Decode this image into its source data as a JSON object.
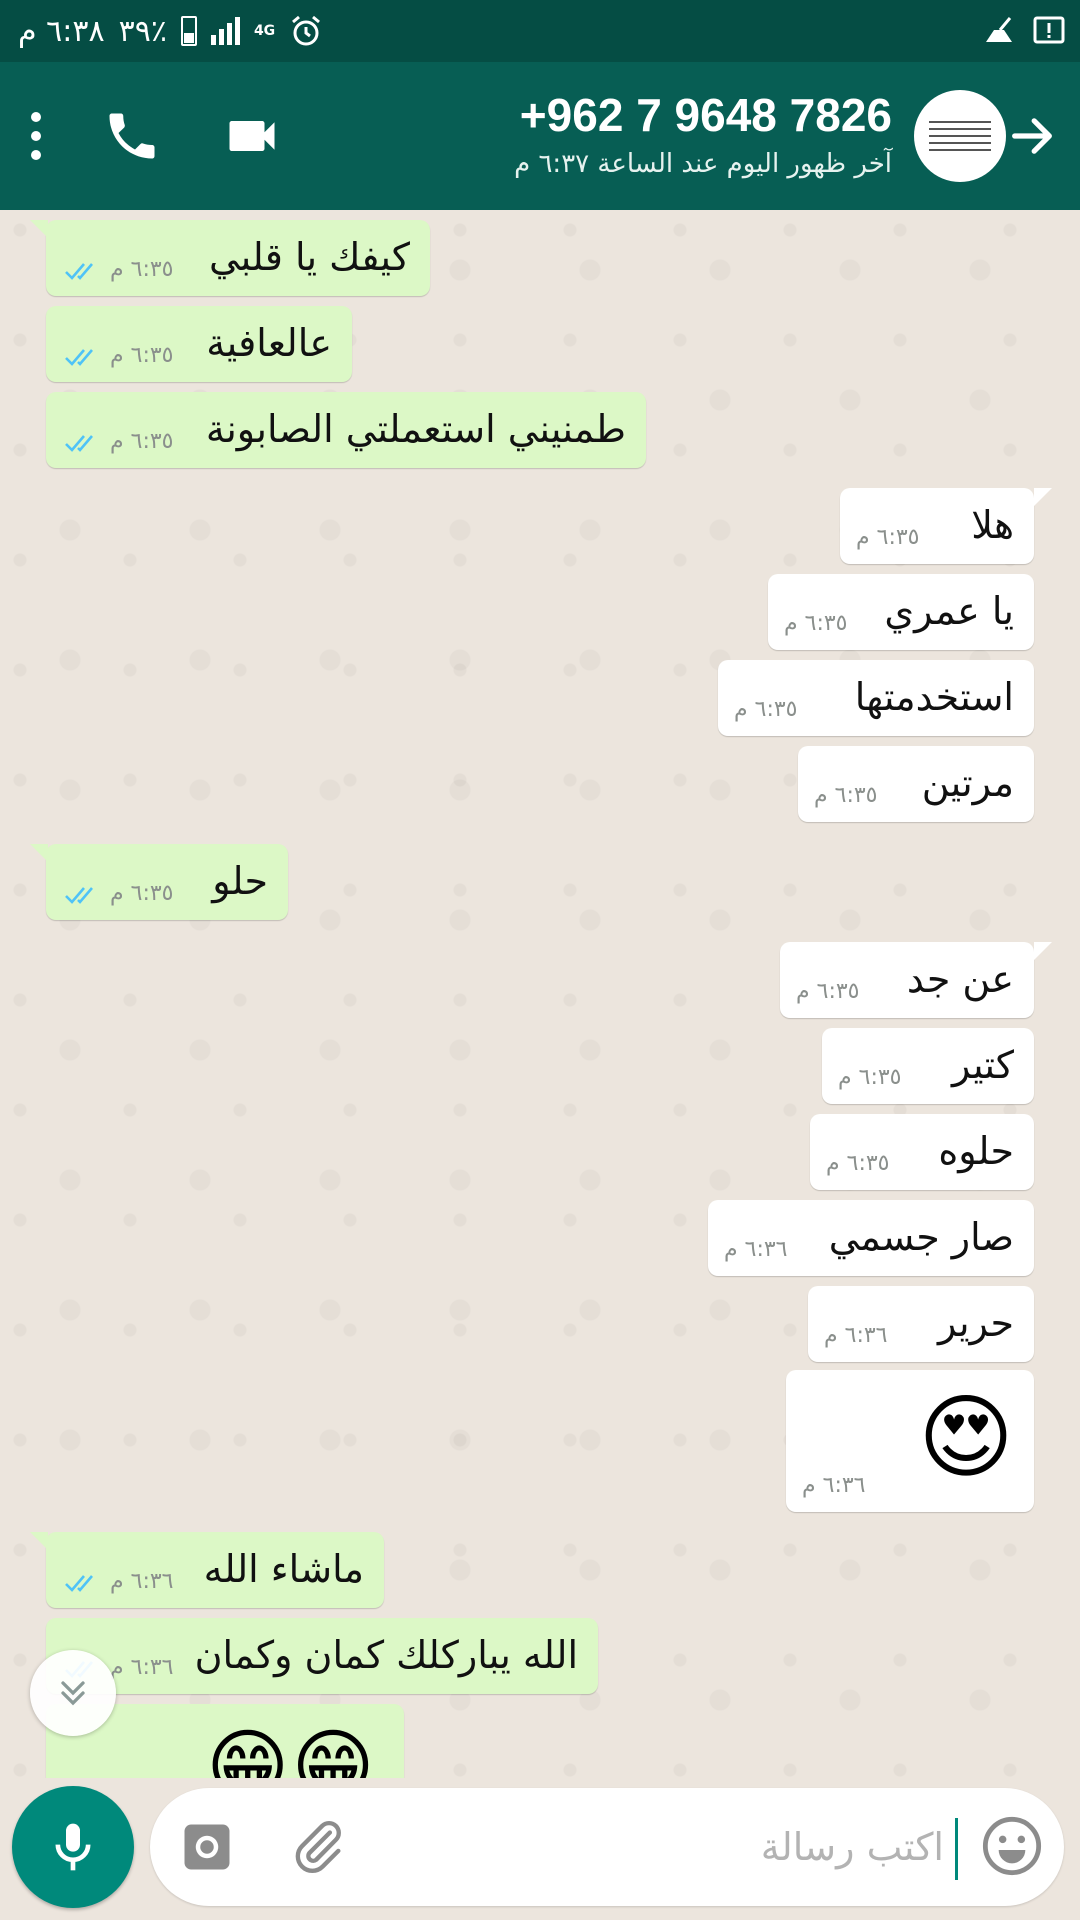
{
  "status_bar": {
    "time": "٦:٣٨ م",
    "battery": "٣٩٪",
    "network": "4G"
  },
  "header": {
    "contact_name": "+962 7 9648 7826",
    "last_seen": "آخر ظهور اليوم عند الساعة ٦:٣٧ م"
  },
  "messages": [
    {
      "dir": "out",
      "text": "كيفك يا قلبي",
      "time": "٦:٣٥ م"
    },
    {
      "dir": "out",
      "text": "عالعافية",
      "time": "٦:٣٥ م"
    },
    {
      "dir": "out",
      "text": "طمنيني استعملتي الصابونة",
      "time": "٦:٣٥ م"
    },
    {
      "dir": "in",
      "text": "هلا",
      "time": "٦:٣٥ م"
    },
    {
      "dir": "in",
      "text": "يا عمري",
      "time": "٦:٣٥ م"
    },
    {
      "dir": "in",
      "text": "استخدمتها",
      "time": "٦:٣٥ م"
    },
    {
      "dir": "in",
      "text": "مرتين",
      "time": "٦:٣٥ م"
    },
    {
      "dir": "out",
      "text": "حلو",
      "time": "٦:٣٥ م"
    },
    {
      "dir": "in",
      "text": "عن جد",
      "time": "٦:٣٥ م"
    },
    {
      "dir": "in",
      "text": "كتير",
      "time": "٦:٣٥ م"
    },
    {
      "dir": "in",
      "text": "حلوه",
      "time": "٦:٣٥ م"
    },
    {
      "dir": "in",
      "text": "صار جسمي",
      "time": "٦:٣٦ م"
    },
    {
      "dir": "in",
      "text": "حرير",
      "time": "٦:٣٦ م"
    },
    {
      "dir": "in",
      "text": "😍",
      "time": "٦:٣٦ م"
    },
    {
      "dir": "out",
      "text": "ماشاء الله",
      "time": "٦:٣٦ م"
    },
    {
      "dir": "out",
      "text": "الله يباركلك كمان وكمان",
      "time": "٦:٣٦ م"
    },
    {
      "dir": "out",
      "text": "😁😁",
      "time": ""
    }
  ],
  "composer": {
    "placeholder": "اكتب رسالة"
  },
  "colors": {
    "status_bar": "#054d44",
    "header": "#075e54",
    "outgoing_bubble": "#dcf8c6",
    "incoming_bubble": "#ffffff",
    "read_ticks": "#4fc3f7",
    "mic_button": "#00897b"
  }
}
